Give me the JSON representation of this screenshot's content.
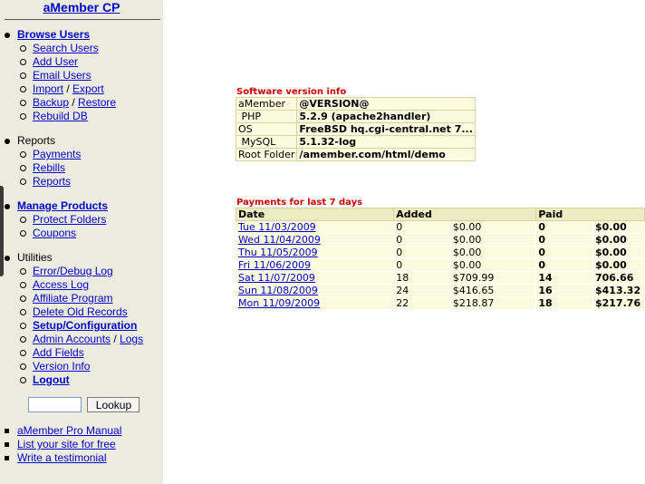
{
  "app_title": "aMember CP",
  "nav": [
    {
      "label": "Browse Users",
      "link": true,
      "items": [
        [
          {
            "label": "Search Users"
          }
        ],
        [
          {
            "label": "Add User"
          }
        ],
        [
          {
            "label": "Email Users"
          }
        ],
        [
          {
            "label": "Import"
          },
          {
            "label": "Export"
          }
        ],
        [
          {
            "label": "Backup"
          },
          {
            "label": "Restore"
          }
        ],
        [
          {
            "label": "Rebuild DB"
          }
        ]
      ]
    },
    {
      "label": "Reports",
      "link": false,
      "items": [
        [
          {
            "label": "Payments"
          }
        ],
        [
          {
            "label": "Rebills"
          }
        ],
        [
          {
            "label": "Reports"
          }
        ]
      ]
    },
    {
      "label": "Manage Products",
      "link": true,
      "items": [
        [
          {
            "label": "Protect Folders"
          }
        ],
        [
          {
            "label": "Coupons"
          }
        ]
      ]
    },
    {
      "label": "Utilities",
      "link": false,
      "items": [
        [
          {
            "label": "Error/Debug Log"
          }
        ],
        [
          {
            "label": "Access Log"
          }
        ],
        [
          {
            "label": "Affiliate Program"
          }
        ],
        [
          {
            "label": "Delete Old Records"
          }
        ],
        [
          {
            "label": "Setup/Configuration",
            "bold": true
          }
        ],
        [
          {
            "label": "Admin Accounts"
          },
          {
            "label": "Logs"
          }
        ],
        [
          {
            "label": "Add Fields"
          }
        ],
        [
          {
            "label": "Version Info"
          }
        ],
        [
          {
            "label": "Logout",
            "bold": true
          }
        ]
      ]
    }
  ],
  "lookup": {
    "input_value": "",
    "button_label": "Lookup"
  },
  "misc_links": [
    "aMember Pro Manual",
    "List your site for free",
    "Write a testimonial"
  ],
  "version_info": {
    "title": "Software version info",
    "rows": [
      {
        "key": "aMember",
        "value": "@VERSION@"
      },
      {
        "key": " PHP",
        "value": "5.2.9 (apache2handler)"
      },
      {
        "key": "OS",
        "value": "FreeBSD hq.cgi-central.net 7..."
      },
      {
        "key": " MySQL",
        "value": "5.1.32-log"
      },
      {
        "key": "Root Folder",
        "value": "/amember.com/html/demo"
      }
    ]
  },
  "payments": {
    "title": "Payments for last 7 days",
    "headers": {
      "date": "Date",
      "added": "Added",
      "paid": "Paid"
    },
    "rows": [
      {
        "date": "Tue 11/03/2009",
        "added_count": "0",
        "added_amount": "$0.00",
        "paid_count": "0",
        "paid_amount": "$0.00"
      },
      {
        "date": "Wed 11/04/2009",
        "added_count": "0",
        "added_amount": "$0.00",
        "paid_count": "0",
        "paid_amount": "$0.00"
      },
      {
        "date": "Thu 11/05/2009",
        "added_count": "0",
        "added_amount": "$0.00",
        "paid_count": "0",
        "paid_amount": "$0.00"
      },
      {
        "date": "Fri 11/06/2009",
        "added_count": "0",
        "added_amount": "$0.00",
        "paid_count": "0",
        "paid_amount": "$0.00"
      },
      {
        "date": "Sat 11/07/2009",
        "added_count": "18",
        "added_amount": "$709.99",
        "paid_count": "14",
        "paid_amount": "706.66"
      },
      {
        "date": "Sun 11/08/2009",
        "added_count": "24",
        "added_amount": "$416.65",
        "paid_count": "16",
        "paid_amount": "$413.32"
      },
      {
        "date": "Mon 11/09/2009",
        "added_count": "22",
        "added_amount": "$218.87",
        "paid_count": "18",
        "paid_amount": "$217.76"
      }
    ]
  }
}
